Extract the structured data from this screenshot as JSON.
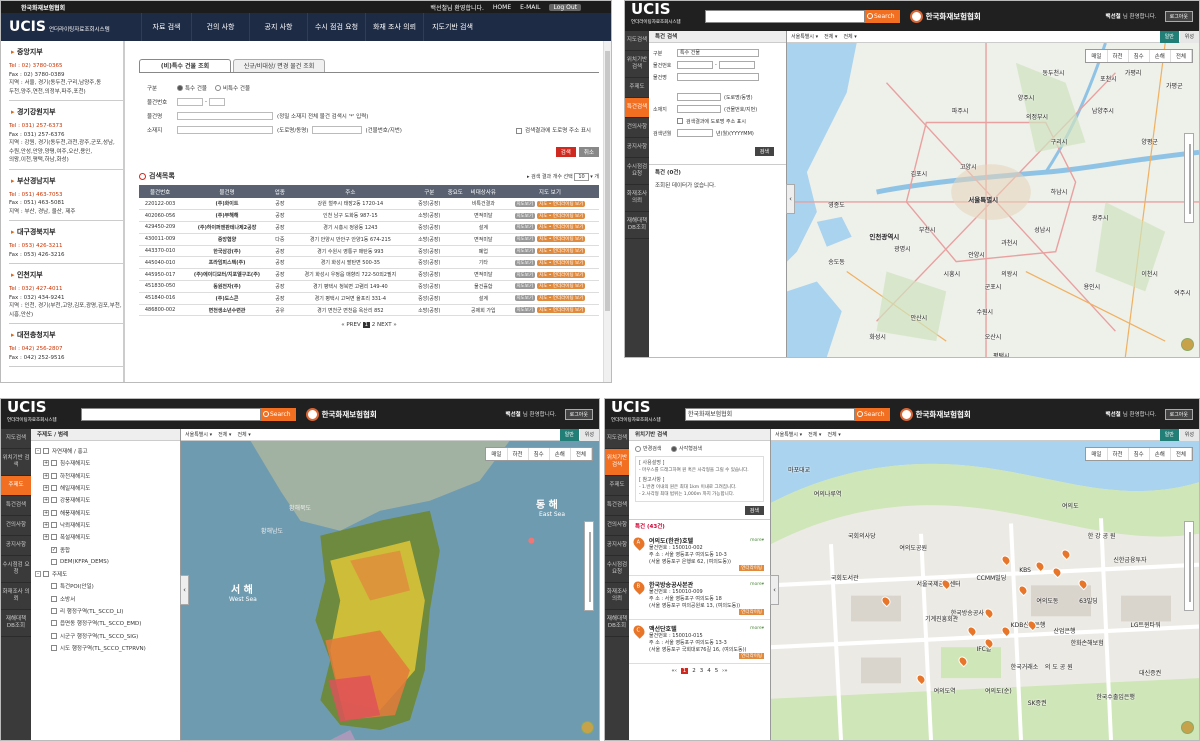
{
  "p1": {
    "top_org": "한국화재보험협회",
    "top_links": [
      "백선철님 환영합니다.",
      "HOME",
      "E-MAIL",
      "Log Out"
    ],
    "logo": "UCIS",
    "logo_sub": "언더라이팅자료조회시스템",
    "menu": [
      "자료 검색",
      "건의 사항",
      "공지 사항",
      "수시 점검 요청",
      "화재 조사 의뢰",
      "지도기반 검색"
    ],
    "branches": [
      {
        "name": "중앙지부",
        "tel": "Tel : 02) 3780-0365",
        "fax": "Fax : 02) 3780-0389",
        "area": [
          "지역 : 서울, 경기(동두천,구리,남양주,동",
          "두천,양주,연천,의정부,파주,포천)"
        ]
      },
      {
        "name": "경기강원지부",
        "tel": "Tel : 031) 257-6373",
        "fax": "Fax : 031) 257-6376",
        "area": [
          "지역 : 강원, 경기(동두천,과천,광주,군포,성남,",
          "수원,안성,안양,양평,여주,오산,용인,",
          "의왕,이천,평택,하남,화성)"
        ]
      },
      {
        "name": "부산경남지부",
        "tel": "Tel : 051) 463-7053",
        "fax": "Fax : 051) 463-5081",
        "area": [
          "지역 : 부산, 경남, 울산, 제주"
        ]
      },
      {
        "name": "대구경북지부",
        "tel": "Tel : 053) 426-3211",
        "fax": "Fax : 053) 426-3216",
        "area": []
      },
      {
        "name": "인천지부",
        "tel": "Tel : 032) 427-4011",
        "fax": "Fax : 032) 434-9241",
        "area": [
          "지역 : 인천, 경기(부천,고양,김포,광명,김포,부천,",
          "시흥,안산)"
        ]
      },
      {
        "name": "대전충청지부",
        "tel": "Tel : 042) 256-2807",
        "fax": "Fax : 042) 252-9516",
        "area": []
      }
    ],
    "tabs": [
      "(비)특수 건물 조회",
      "신규/비대상/ 면경 물건 조회"
    ],
    "form": {
      "kind_label": "구분",
      "kind_options": [
        "특수 건물",
        "비특수 건물"
      ],
      "no_label": "물건번호",
      "name_label": "물건명",
      "name_hint": "(정밀 소재지 전체 물건 검색시 '*' 입력)",
      "addr_label": "소재지",
      "addr_hint1": "(도로명/동명)",
      "addr_hint2": "(건물번호/지번)",
      "addr_check": "검색결과에 도로명 주소 표시",
      "search": "검색",
      "cancel": "취소"
    },
    "results_title": "검색목록",
    "results_opts": "▸ 검색 결과 개수 선택",
    "page_size": "10",
    "page_size_btn": "개",
    "columns": [
      "물건번호",
      "물건명",
      "업종",
      "주소",
      "구분",
      "중요도",
      "비대상사유",
      "지도 보기"
    ],
    "rows": [
      [
        "220122-003",
        "(주)화이트",
        "공장",
        "강원 철주시 태장2동 1720-14",
        "중앙(공장)",
        "",
        "비특건결과"
      ],
      [
        "402060-056",
        "(주)부해해",
        "공장",
        "인천 남구 도화동 987-15",
        "소방(공장)",
        "",
        "면적미달"
      ],
      [
        "429450-209",
        "(주)하이퍼앤판테나제2공장",
        "공장",
        "경기 시흥시 정왕동 1243",
        "중앙(공장)",
        "",
        "설계"
      ],
      [
        "430011-009",
        "중앙협양",
        "다중",
        "경기 안양시 만안구 안양1동 674-215",
        "소방(공장)",
        "",
        "면적미달"
      ],
      [
        "443370-010",
        "한국삼강(주)",
        "공장",
        "경기 수원시 영통구 매탄동 993",
        "중앙(공장)",
        "",
        "폐업"
      ],
      [
        "445040-010",
        "프라임피스텍(주)",
        "공장",
        "경기 화성시 팔탄면 500-35",
        "중앙(공장)",
        "",
        "기타"
      ],
      [
        "445950-017",
        "(주)에이디모터/지포엘구조(주)",
        "공장",
        "경기 화성시 우정읍 매향리 722-50외2필지",
        "중앙(공장)",
        "",
        "면적미달"
      ],
      [
        "451830-050",
        "동원전자(주)",
        "공장",
        "경기 평택시 청북면 고렴리 149-40",
        "중앙(공장)",
        "",
        "물건휼합"
      ],
      [
        "451840-016",
        "(주)도스콘",
        "공장",
        "경기 평택시 고덕면 율포리 331-4",
        "중앙(공장)",
        "",
        "설계"
      ],
      [
        "486800-002",
        "면천생소년수련관",
        "공유",
        "경기 면천군 면천읍 옥산리 852",
        "소방(공장)",
        "",
        "공제회 가입"
      ]
    ],
    "btn_view": "지도보기",
    "btn_info": "지도 • 언더라이팅 보기",
    "pager": {
      "prev": "« PREV",
      "cur": "1",
      "next_page": "2",
      "next": "NEXT »"
    }
  },
  "app": {
    "logo": "UCIS",
    "logo_sub": "언더라이팅자료조회시스템",
    "search_btn": "Search",
    "org": "한국화재보험협회",
    "welcome_name": "백선철",
    "welcome_rest": "님 환영합니다.",
    "logout": "로그아웃",
    "nav": [
      "지도검색",
      "위치기반 검색",
      "주제도",
      "특건검색",
      "건의사항",
      "공지사항",
      "수시점검 요청",
      "화재조사 의뢰",
      "재해대책 DB조회"
    ],
    "map_selects": [
      "서울특별시",
      "전체",
      "전체"
    ],
    "map_types": [
      "일반",
      "위성"
    ],
    "tools": [
      "매일",
      "하천",
      "침수",
      "손해",
      "전체"
    ]
  },
  "p2": {
    "panel_title": "특건 검색",
    "f_kind": "구분",
    "f_kind_val": "특수 건물",
    "f_no": "물건번호",
    "f_name": "물건명",
    "f_addr": "소재지",
    "hint1": "(도로명/동명)",
    "hint2": "(건물번호/지번)",
    "chk": "검색결과에 도로명 주소 표시",
    "f_year": "검색년월",
    "year_hint": "년(월)(YYYYMM)",
    "btn": "검색",
    "result_title": "특건 (0건)",
    "empty": "조회된 데이터가 없습니다.",
    "places": [
      "동두천시",
      "포천시",
      "가평군",
      "양주시",
      "의정부시",
      "남양주시",
      "가평리",
      "고양시",
      "김포시",
      "서울특별시",
      "구리시",
      "양평군",
      "인천광역시",
      "부천시",
      "광명시",
      "하남시",
      "시흥시",
      "안양시",
      "과천시",
      "성남시",
      "광주시",
      "안산시",
      "군포시",
      "의왕시",
      "화성시",
      "오산시",
      "용인시",
      "평택시",
      "이천시",
      "여주시",
      "파주시",
      "송도동",
      "영종도",
      "수원시"
    ]
  },
  "p3": {
    "panel_title": "주제도 / 범례",
    "tree": [
      {
        "t": "자연재해 / 홍고",
        "lvl": 0,
        "pm": "-"
      },
      {
        "t": "침수재해지도",
        "lvl": 1,
        "pm": "+"
      },
      {
        "t": "하천재해지도",
        "lvl": 1,
        "pm": "+"
      },
      {
        "t": "해일재해지도",
        "lvl": 1,
        "pm": "+"
      },
      {
        "t": "강풍재해지도",
        "lvl": 1,
        "pm": "+"
      },
      {
        "t": "해풍재해지도",
        "lvl": 1,
        "pm": "+"
      },
      {
        "t": "낙뢰재해지도",
        "lvl": 1,
        "pm": "+"
      },
      {
        "t": "폭설재해지도",
        "lvl": 1,
        "pm": "+"
      },
      {
        "t": "종합",
        "lvl": 1,
        "pm": "",
        "checked": true
      },
      {
        "t": "DEM(KFPA_DEMS)",
        "lvl": 1,
        "pm": ""
      },
      {
        "t": "주제도",
        "lvl": 0,
        "pm": "-"
      },
      {
        "t": "특건POI(안일)",
        "lvl": 1,
        "pm": ""
      },
      {
        "t": "소방서",
        "lvl": 1,
        "pm": ""
      },
      {
        "t": "리 행정구역(TL_SCCO_LI)",
        "lvl": 1,
        "pm": ""
      },
      {
        "t": "읍면동 행정구역(TL_SCCO_EMD)",
        "lvl": 1,
        "pm": ""
      },
      {
        "t": "시군구 행정구역(TL_SCCO_SIG)",
        "lvl": 1,
        "pm": ""
      },
      {
        "t": "시도 행정구역(TL_SCCO_CTPRVN)",
        "lvl": 1,
        "pm": ""
      }
    ],
    "sea_e": "동 해",
    "sea_e_en": "East Sea",
    "sea_w": "서 해",
    "sea_w_en": "West Sea",
    "land": [
      "황해남도",
      "황해북도"
    ]
  },
  "p4": {
    "search_val": "한국화재보험협회",
    "panel_title": "위치기반 검색",
    "mode": [
      "반경검색",
      "사각형검색"
    ],
    "use_title": "[ 사용설명 ]",
    "use_lines": [
      "- 마우스를 드래그하여 원 혹은 사각형을 그릴 수 있습니다."
    ],
    "ref_title": "[ 참고사항 ]",
    "ref_lines": [
      "- 1.반경 이내의 원은 최대 1km 이내로 그려집니다.",
      "- 2.사각형 최대 범위는 1,000m 까지 가능합니다."
    ],
    "btn": "검색",
    "result_title": "특건 (43건)",
    "items": [
      {
        "pin": "A",
        "name": "여의도(한관)호텔",
        "no": "물건번호 : 150010-002",
        "addr": "주    소 : 서울 영등포구 여의도동 10-3",
        "road": "(서울 영등포구 은행로 62, (여의도동))"
      },
      {
        "pin": "B",
        "name": "한국방송공사본관",
        "no": "물건번호 : 150010-009",
        "addr": "주    소 : 서울 영등포구 여의도동 18",
        "road": "(서울 영등포구 여의공원로 13, (여의도동))"
      },
      {
        "pin": "C",
        "name": "맥선단호텔",
        "no": "물건번호 : 150010-015",
        "addr": "주    소 : 서울 영등포구 여의도동 13-3",
        "road": "(서울 영등포구 국회대로76길 16, (여의도동))"
      }
    ],
    "more": "more▾",
    "tag": "언더라이팅",
    "pages": [
      "1",
      "2",
      "3",
      "4",
      "5"
    ],
    "places": [
      "여의도",
      "한 강 공 원",
      "국회의사당",
      "여의도공원",
      "한국방송공사",
      "KBS",
      "LG트윈타워",
      "CCMM빌딩",
      "여의도역",
      "여의도동",
      "KDB산업은행",
      "서울국제금융센터",
      "63빌딩",
      "한국거래소",
      "국회도서관",
      "마포대교",
      "여의나루역",
      "한화손해보험",
      "SK증권",
      "IFC몰",
      "대신증권",
      "한국수출입은행",
      "기계진흥회관",
      "여의도(순)",
      "의 도 공 원",
      "신한금융투자",
      "산업은행"
    ]
  }
}
